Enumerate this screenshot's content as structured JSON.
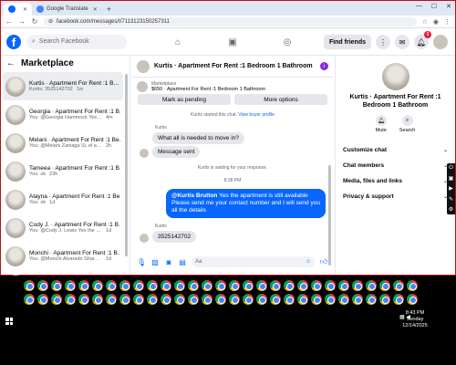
{
  "browser": {
    "tabs": [
      {
        "label": "",
        "icon": "facebook-icon",
        "active": true
      },
      {
        "label": "Google Translate",
        "icon": "google-translate-icon",
        "active": false
      }
    ],
    "url": "facebook.com/messages/t/7113123150257311"
  },
  "fb": {
    "search_placeholder": "Search Facebook",
    "find_friends": "Find friends",
    "notif_count": "9"
  },
  "marketplace": {
    "title": "Marketplace",
    "conversations": [
      {
        "name": "Kurtis · Apartment For Rent :1 B...",
        "msg": "Kurtis: 3525142702",
        "time": "1m",
        "active": true
      },
      {
        "name": "Georgia · Apartment For Rent :1 B...",
        "msg": "You: @Georgia Hammock Yes the ...",
        "time": "4m",
        "active": false
      },
      {
        "name": "Melani · Apartment For Rent :1 Be...",
        "msg": "You: @Melani Zaniaga Si, el aparta...",
        "time": "2h",
        "active": false
      },
      {
        "name": "Tameea · Apartment For Rent :1 B...",
        "msg": "You: ok",
        "time": "23h",
        "active": false
      },
      {
        "name": "Alayna · Apartment For Rent :1 Be...",
        "msg": "You: ok",
        "time": "1d",
        "active": false
      },
      {
        "name": "Cody J. · Apartment For Rent :1 B...",
        "msg": "You: @Cody J. Lewis Yes the apartm...",
        "time": "1d",
        "active": false
      },
      {
        "name": "Monchi · Apartment For Rent :1 Be...",
        "msg": "You: @Monchi Alvarado Share y...",
        "time": "1d",
        "active": false
      },
      {
        "name": "Tobreis · Apartment For Rent :1 B...",
        "msg": "You: ok",
        "time": "1d",
        "active": false
      }
    ]
  },
  "chat": {
    "title": "Kurtis · Apartment For Rent :1 Bedroom 1 Bathroom",
    "listing_label": "Marketplace",
    "listing_text": "$650 · Apartment For Rent :1 Bedroom 1 Bathroom",
    "mark_pending": "Mark as pending",
    "more_options": "More options",
    "started_chat": "Kurtis started this chat.",
    "view_profile": "View buyer profile",
    "sender_name": "Kurtis",
    "msg1": "What all is needed to move in?",
    "msg2": "Message sent",
    "waiting": "Kurtis is waiting for your response.",
    "time": "8:38 PM",
    "out_mention": "@Kurtis Brutton",
    "out_text": " Yes the apartment is still available Please send me your contact number and I will send you all the details",
    "sender_name2": "Kurtis",
    "msg3": "3525142702",
    "composer_placeholder": "Aa"
  },
  "details": {
    "name": "Kurtis · Apartment For Rent :1 Bedroom 1 Bathroom",
    "mute": "Mute",
    "search": "Search",
    "sections": [
      "Customize chat",
      "Chat members",
      "Media, files and links",
      "Privacy & support"
    ]
  },
  "tray": {
    "time": "8:43 PM",
    "day": "Sunday",
    "date": "12/14/2025"
  }
}
